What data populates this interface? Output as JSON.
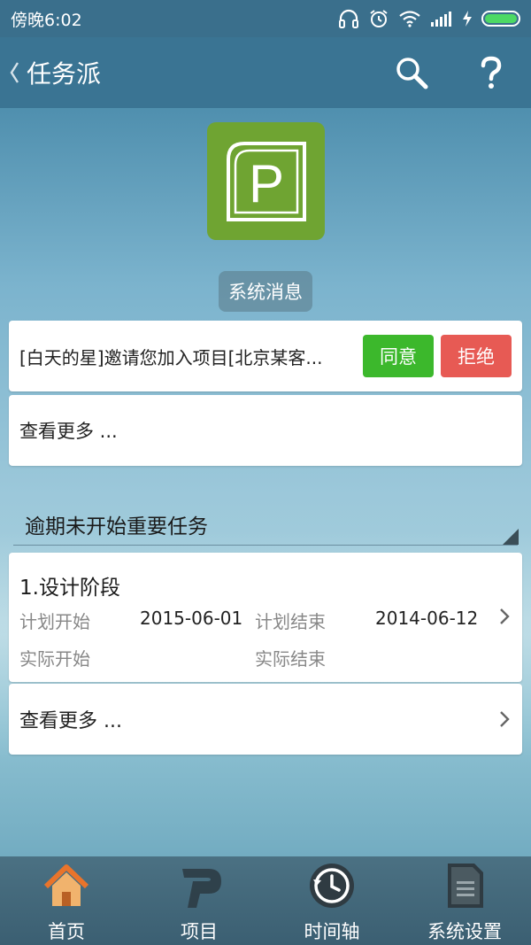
{
  "status_bar": {
    "time": "傍晚6:02",
    "battery_level": 1.0
  },
  "header": {
    "title": "任务派",
    "back_icon": "chevron-left-icon",
    "search_icon": "search-icon",
    "help_icon": "help-icon"
  },
  "logo": {
    "letter": "P",
    "color": "#6fa432"
  },
  "system_message": {
    "badge": "系统消息",
    "text": "[白天的星]邀请您加入项目[北京某客...",
    "agree_label": "同意",
    "reject_label": "拒绝",
    "more_label": "查看更多 ..."
  },
  "overdue": {
    "title": "逾期未开始重要任务",
    "task": {
      "name": "1.设计阶段",
      "plan_start_label": "计划开始",
      "plan_start_value": "2015-06-01",
      "plan_end_label": "计划结束",
      "plan_end_value": "2014-06-12",
      "actual_start_label": "实际开始",
      "actual_end_label": "实际结束"
    },
    "more_label": "查看更多 ..."
  },
  "tabs": [
    {
      "label": "首页",
      "icon": "home-icon"
    },
    {
      "label": "项目",
      "icon": "project-icon"
    },
    {
      "label": "时间轴",
      "icon": "history-icon"
    },
    {
      "label": "系统设置",
      "icon": "settings-document-icon"
    }
  ],
  "colors": {
    "agree": "#3cb82c",
    "reject": "#e75a54",
    "header": "#3a7493"
  }
}
